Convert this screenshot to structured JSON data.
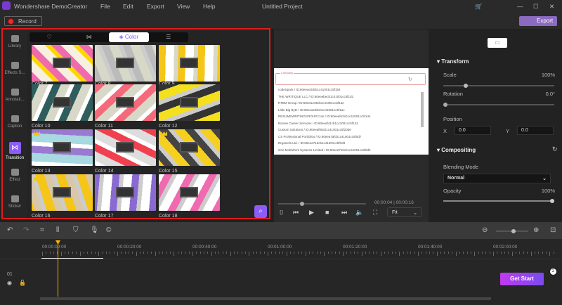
{
  "app": {
    "title": "Wondershare DemoCreator",
    "project": "Untitled Project",
    "menu": [
      "File",
      "Edit",
      "Export",
      "View",
      "Help"
    ],
    "record": "Record",
    "export": "Export"
  },
  "sidebar": [
    {
      "label": "Library",
      "icon": "folder-icon"
    },
    {
      "label": "Effects S...",
      "icon": "store-icon"
    },
    {
      "label": "Annotati...",
      "icon": "annotation-icon"
    },
    {
      "label": "Caption",
      "icon": "caption-icon"
    },
    {
      "label": "Transition",
      "icon": "transition-icon",
      "active": true
    },
    {
      "label": "Effect",
      "icon": "magic-wand-icon"
    },
    {
      "label": "Sticker",
      "icon": "sticker-icon"
    }
  ],
  "tabs": [
    "♡",
    "⋈",
    "◈ Color",
    "☰"
  ],
  "thumbnails": [
    {
      "label": "Color 7",
      "crown": false,
      "c": [
        "#f06ab0",
        "#f5f0e0",
        "#ffd700"
      ]
    },
    {
      "label": "Color 8",
      "crown": false,
      "c": [
        "#bbb",
        "#d8d8c8",
        "#ccc"
      ]
    },
    {
      "label": "Color 9",
      "crown": false,
      "c": [
        "#f5c518",
        "#fff",
        "#d8d8c8"
      ]
    },
    {
      "label": "Color 10",
      "crown": false,
      "c": [
        "#2f5d5d",
        "#d8d8c8",
        "#fff"
      ]
    },
    {
      "label": "Color 11",
      "crown": false,
      "c": [
        "#f56a7a",
        "#d8d8c8",
        "#fff"
      ]
    },
    {
      "label": "Color 12",
      "crown": false,
      "c": [
        "#333",
        "#f5e020",
        "#ccc"
      ]
    },
    {
      "label": "Color 13",
      "crown": true,
      "c": [
        "#9a7ad0",
        "#a8d8e0",
        "#fff"
      ]
    },
    {
      "label": "Color 14",
      "crown": false,
      "c": [
        "#f04050",
        "#ddd",
        "#fff"
      ]
    },
    {
      "label": "Color 15",
      "crown": true,
      "c": [
        "#444",
        "#f5d020",
        "#ccc"
      ]
    },
    {
      "label": "Color 16",
      "crown": true,
      "c": [
        "#d8c8a8",
        "#f5c518",
        "#ccc"
      ]
    },
    {
      "label": "Color 17",
      "crown": false,
      "c": [
        "#8a6ad0",
        "#fff",
        "#ccc"
      ]
    },
    {
      "label": "Color 18",
      "crown": false,
      "c": [
        "#f06ab0",
        "#fff",
        "#ccc"
      ]
    }
  ],
  "preview": {
    "field_label": "Company",
    "options": [
      "codeSpark / ID:60eeac0dcb1c41001cc5f1b4",
      "THE WRITIQUE LLC / ID:60eeabecb1c41001cc5f1d2",
      "RTBM Group / ID:60eeae35cb1c41001cc5f1ae",
      "Little Big Byte / ID:60eeae6bcb1c41001cc5f1ac",
      "RESUMEWRITINGGROUP.Com / ID:60eeafe2cb1c41001cc5f144",
      "Bonnie Career Services / ID:60eeaf41cb1c41001cc5f142",
      "Custom Solutions / ID:60eeaf05cb1c41001cc5f20de",
      "CS Professional Portfolios / ID:60eea7afcb1c41001cc5f0d7",
      "Ergotools Ltd. / ID:60eea716cb1c41001cc5f0d3",
      "One MobiWork Systems Limited / ID:60eea715cb1c41001cc5f0d2"
    ],
    "time_current": "00:00:04",
    "time_total": "00:00:16",
    "fit": "Fit",
    "progress": 0.27
  },
  "properties": {
    "transform": "Transform",
    "scale_label": "Scale",
    "scale": "100%",
    "scale_level": 0.2,
    "rotation_label": "Rotation",
    "rotation": "0.0°",
    "position_label": "Position",
    "x_label": "X",
    "x": "0.0",
    "y_label": "Y",
    "y": "0.0",
    "compositing": "Compositing",
    "blending_label": "Blending Mode",
    "blending": "Normal",
    "opacity_label": "Opacity",
    "opacity": "100%"
  },
  "timeline": {
    "ticks": [
      "00:00:00:00",
      "00:00:20:00",
      "00:00:40:00",
      "00:01:00:00",
      "00:01:20:00",
      "00:01:40:00",
      "00:02:00:00"
    ],
    "track": "01",
    "get_start": "Get Start",
    "badge": "2"
  }
}
